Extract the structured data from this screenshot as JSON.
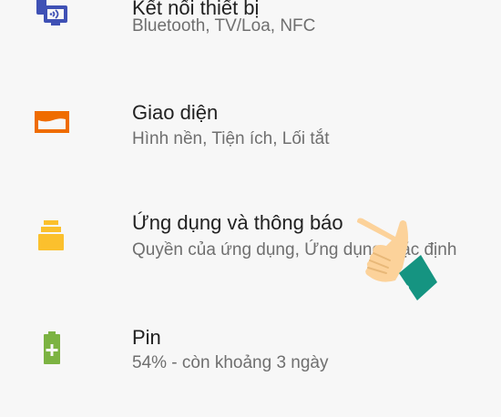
{
  "settings_list": [
    {
      "title": "Kết nối thiết bị",
      "subtitle": "Bluetooth, TV/Loa, NFC",
      "icon": "connected-devices-icon",
      "color": "#3f51b5"
    },
    {
      "title": "Giao diện",
      "subtitle": "Hình nền, Tiện ích, Lối tắt",
      "icon": "display-icon",
      "color": "#ef6c00"
    },
    {
      "title": "Ứng dụng và thông báo",
      "subtitle": "Quyền của ứng dụng, Ứng dụng mặc định",
      "icon": "apps-icon",
      "color": "#fbc02d"
    },
    {
      "title": "Pin",
      "subtitle": "54% - còn khoảng 3 ngày",
      "icon": "battery-icon",
      "color": "#7cb342"
    }
  ],
  "overlay": {
    "icon": "pointing-hand-icon",
    "sleeve_color": "#159481",
    "skin_color": "#fcd29a"
  }
}
